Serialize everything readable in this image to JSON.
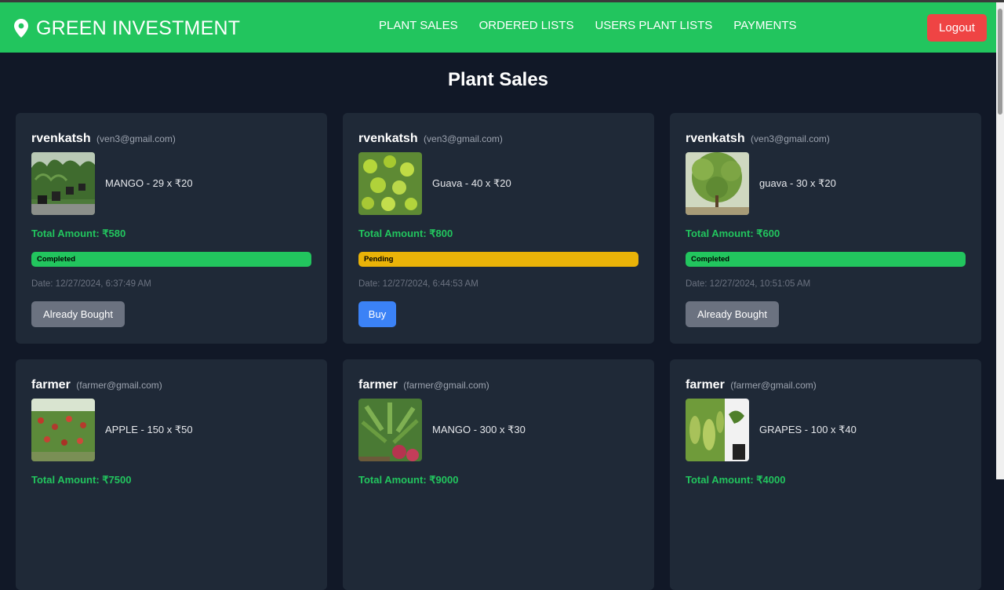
{
  "navbar": {
    "brand": "GREEN INVESTMENT",
    "brand_icon": "map-pin-icon",
    "links": [
      "PLANT SALES",
      "ORDERED LISTS",
      "USERS PLANT LISTS",
      "PAYMENTS"
    ],
    "logout_label": "Logout"
  },
  "page_title": "Plant Sales",
  "colors": {
    "navbar": "#22c55e",
    "background": "#111827",
    "card": "#1f2937",
    "completed": "#22c55e",
    "pending": "#eab308",
    "logout": "#ef4444",
    "buy": "#3b82f6",
    "already_bought": "#6b7280"
  },
  "sales": [
    {
      "seller": "rvenkatsh",
      "email": "(ven3@gmail.com)",
      "product": "MANGO - 29 x ₹20",
      "image": "mango-plants-in-pots",
      "total": "Total Amount: ₹580",
      "status": "Completed",
      "date": "Date: 12/27/2024, 6:37:49 AM",
      "action": "Already Bought"
    },
    {
      "seller": "rvenkatsh",
      "email": "(ven3@gmail.com)",
      "product": "Guava - 40 x ₹20",
      "image": "guava-fruits",
      "total": "Total Amount: ₹800",
      "status": "Pending",
      "date": "Date: 12/27/2024, 6:44:53 AM",
      "action": "Buy"
    },
    {
      "seller": "rvenkatsh",
      "email": "(ven3@gmail.com)",
      "product": "guava - 30 x ₹20",
      "image": "guava-tree",
      "total": "Total Amount: ₹600",
      "status": "Completed",
      "date": "Date: 12/27/2024, 10:51:05 AM",
      "action": "Already Bought"
    },
    {
      "seller": "farmer",
      "email": "(farmer@gmail.com)",
      "product": "APPLE - 150 x ₹50",
      "image": "apple-orchard",
      "total": "Total Amount: ₹7500"
    },
    {
      "seller": "farmer",
      "email": "(farmer@gmail.com)",
      "product": "MANGO - 300 x ₹30",
      "image": "mango-plant-with-fruit",
      "total": "Total Amount: ₹9000"
    },
    {
      "seller": "farmer",
      "email": "(farmer@gmail.com)",
      "product": "GRAPES - 100 x ₹40",
      "image": "grape-vines",
      "total": "Total Amount: ₹4000"
    }
  ]
}
